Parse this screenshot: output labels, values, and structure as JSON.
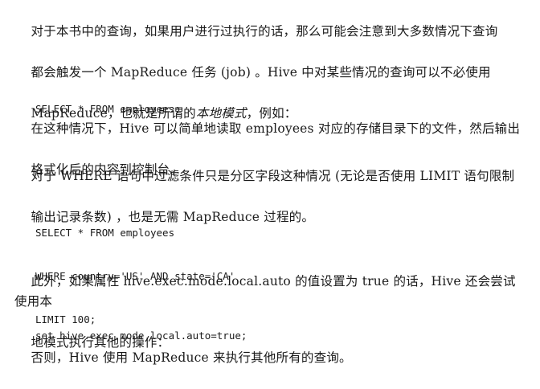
{
  "paragraphs": {
    "p1": {
      "line1": "对于本书中的查询，如果用户进行过执行的话，那么可能会注意到大多数情况下查询",
      "line2": "都会触发一个 MapReduce 任务 (job) 。Hive 中对某些情况的查询可以不必使用",
      "line3_before": "MapReduce，也就是所谓的",
      "line3_em": "本地模式",
      "line3_after": "，例如："
    },
    "p2": {
      "line1": "在这种情况下，Hive 可以简单地读取 employees 对应的存储目录下的文件，然后输出",
      "line2": "格式化后的内容到控制台。"
    },
    "p3": {
      "line1": "对于 WHERE 语句中过滤条件只是分区字段这种情况 (无论是否使用 LIMIT 语句限制",
      "line2": "输出记录条数) ，也是无需 MapReduce 过程的。"
    },
    "p4": {
      "line1": "此外，如果属性 hive.exec.mode.local.auto 的值设置为 true 的话，Hive 还会尝试使用本",
      "line2": "地模式执行其他的操作："
    },
    "p5": {
      "line1": "否则，Hive 使用 MapReduce 来执行其他所有的查询。"
    }
  },
  "code_blocks": {
    "c1": [
      "SELECT * FROM employees;"
    ],
    "c2": [
      "SELECT * FROM employees",
      "WHERE country='US' AND state='CA'",
      "LIMIT 100;"
    ],
    "c3": [
      "set hive.exec.mode.local.auto=true;"
    ]
  }
}
